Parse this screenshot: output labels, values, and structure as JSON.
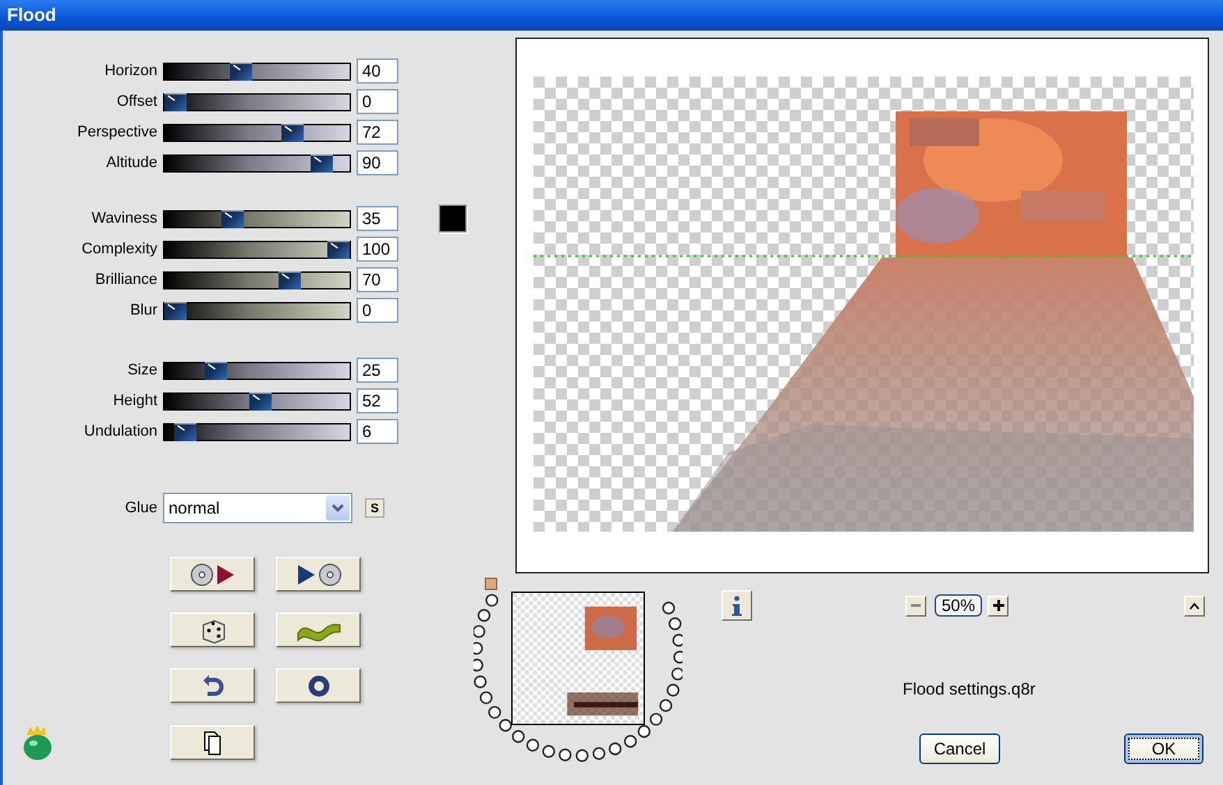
{
  "window": {
    "title": "Flood"
  },
  "slider_groups": [
    [
      {
        "label": "Horizon",
        "value": "40",
        "level": 0.4
      },
      {
        "label": "Offset",
        "value": "0",
        "level": 0
      },
      {
        "label": "Perspective",
        "value": "72",
        "level": 0.72
      },
      {
        "label": "Altitude",
        "value": "90",
        "level": 0.9
      }
    ],
    [
      {
        "label": "Waviness",
        "value": "35",
        "level": 0.35
      },
      {
        "label": "Complexity",
        "value": "100",
        "level": 1
      },
      {
        "label": "Brilliance",
        "value": "70",
        "level": 0.7
      },
      {
        "label": "Blur",
        "value": "0",
        "level": 0
      }
    ],
    [
      {
        "label": "Size",
        "value": "25",
        "level": 0.25
      },
      {
        "label": "Height",
        "value": "52",
        "level": 0.52
      },
      {
        "label": "Undulation",
        "value": "6",
        "level": 0.06
      }
    ]
  ],
  "color_well": {
    "color": "#000000"
  },
  "glue": {
    "label": "Glue",
    "value": "normal",
    "side_button": "S"
  },
  "zoom": {
    "value": "50%"
  },
  "settings_file": "Flood settings.q8r",
  "buttons": [
    {
      "label": "Cancel",
      "focused": false
    },
    {
      "label": "OK",
      "focused": true
    }
  ]
}
